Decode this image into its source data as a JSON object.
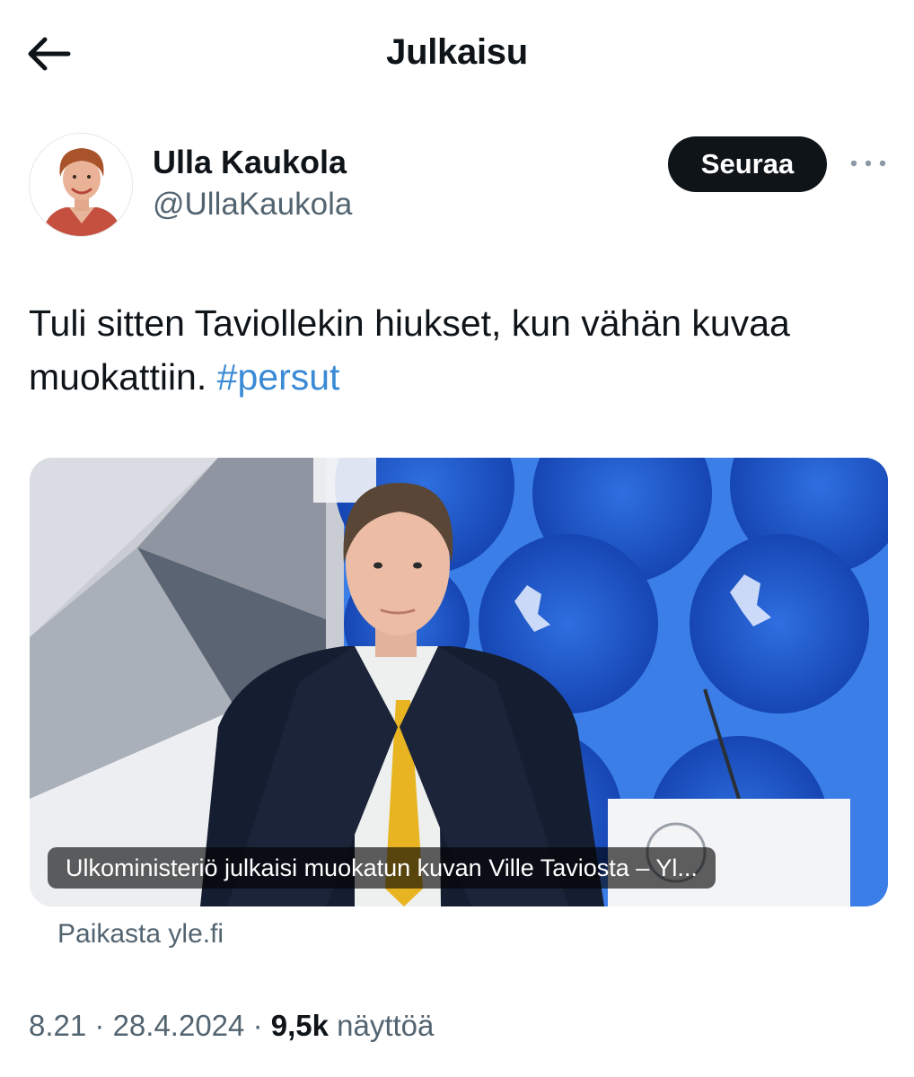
{
  "header": {
    "title": "Julkaisu",
    "back_icon": "arrow-left-icon"
  },
  "author": {
    "display_name": "Ulla Kaukola",
    "handle": "@UllaKaukola",
    "follow_label": "Seuraa",
    "more_icon": "ellipsis-icon"
  },
  "tweet": {
    "text": "Tuli sitten Taviollekin hiukset, kun vähän kuvaa muokattiin.",
    "hashtag": "#persut"
  },
  "card": {
    "caption": "Ulkoministeriö julkaisi muokatun kuvan Ville Taviosta – Yl...",
    "source": "Paikasta yle.fi"
  },
  "meta": {
    "time": "8.21",
    "separator": "·",
    "date": "28.4.2024",
    "views_count": "9,5k",
    "views_label": "näyttöä"
  },
  "colors": {
    "text": "#0f1419",
    "secondary": "#536471",
    "link": "#3a8ad6",
    "button": "#0f1419"
  }
}
